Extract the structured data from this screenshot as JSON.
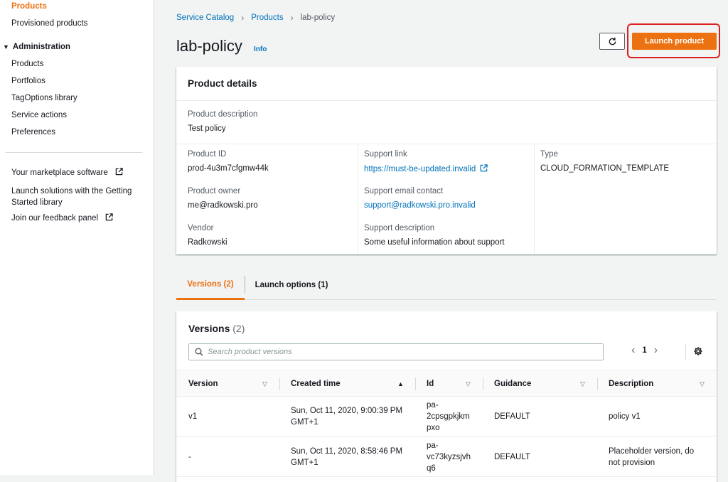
{
  "sidebar": {
    "top_items": [
      "Products",
      "Provisioned products"
    ],
    "section_title": "Administration",
    "admin_items": [
      "Products",
      "Portfolios",
      "TagOptions library",
      "Service actions",
      "Preferences"
    ],
    "extra_items": {
      "marketplace": "Your marketplace software",
      "getting_started": "Launch solutions with the Getting Started library",
      "feedback": "Join our feedback panel"
    }
  },
  "breadcrumb": [
    "Service Catalog",
    "Products",
    "lab-policy"
  ],
  "page": {
    "title": "lab-policy",
    "info": "Info",
    "launch_label": "Launch product"
  },
  "details": {
    "title": "Product details",
    "description_label": "Product description",
    "description": "Test policy",
    "product_id_label": "Product ID",
    "product_id": "prod-4u3m7cfgmw44k",
    "owner_label": "Product owner",
    "owner": "me@radkowski.pro",
    "vendor_label": "Vendor",
    "vendor": "Radkowski",
    "support_link_label": "Support link",
    "support_link": "https://must-be-updated.invalid",
    "support_email_label": "Support email contact",
    "support_email": "support@radkowski.pro.invalid",
    "support_desc_label": "Support description",
    "support_desc": "Some useful information about support",
    "type_label": "Type",
    "type": "CLOUD_FORMATION_TEMPLATE"
  },
  "tabs": [
    "Versions (2)",
    "Launch options (1)"
  ],
  "versions": {
    "title": "Versions",
    "count": "(2)",
    "search_placeholder": "Search product versions",
    "page": "1",
    "columns": [
      "Version",
      "Created time",
      "Id",
      "Guidance",
      "Description"
    ],
    "rows": [
      {
        "version": "v1",
        "created": [
          "Sun, Oct 11, 2020, 9:00:39 PM",
          "GMT+1"
        ],
        "id": [
          "pa-",
          "2cpsgpkjkm",
          "pxo"
        ],
        "guidance": "DEFAULT",
        "description": [
          "policy v1"
        ]
      },
      {
        "version": "-",
        "created": [
          "Sun, Oct 11, 2020, 8:58:46 PM",
          "GMT+1"
        ],
        "id": [
          "pa-",
          "vc73kyzsjvh",
          "q6"
        ],
        "guidance": "DEFAULT",
        "description": [
          "Placeholder version, do",
          "not provision"
        ]
      }
    ]
  },
  "colors": {
    "accent": "#ec7211",
    "link": "#0073bb",
    "highlight": "#e02020"
  }
}
